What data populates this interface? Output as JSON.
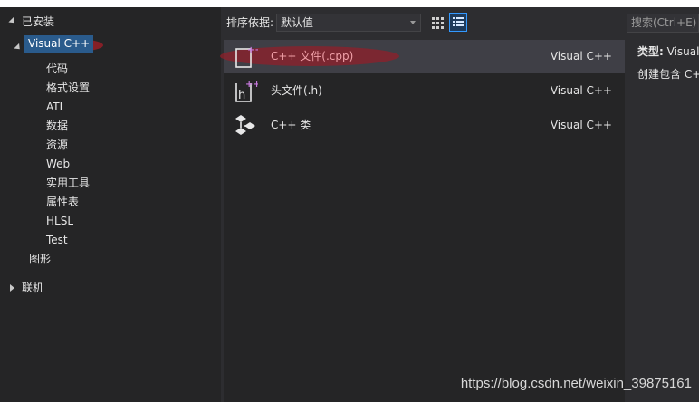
{
  "tree": {
    "installed_label": "已安装",
    "selected": "Visual C++",
    "children": [
      "代码",
      "格式设置",
      "ATL",
      "数据",
      "资源",
      "Web",
      "实用工具",
      "属性表",
      "HLSL",
      "Test"
    ],
    "graphics_label": "图形",
    "online_label": "联机"
  },
  "toolbar": {
    "sort_label": "排序依据:",
    "sort_value": "默认值"
  },
  "templates": [
    {
      "name": "C++ 文件(.cpp)",
      "lang": "Visual C++",
      "icon": "cpp-file-icon"
    },
    {
      "name": "头文件(.h)",
      "lang": "Visual C++",
      "icon": "header-file-icon"
    },
    {
      "name": "C++ 类",
      "lang": "Visual C++",
      "icon": "class-icon"
    }
  ],
  "search": {
    "placeholder": "搜索(Ctrl+E)"
  },
  "details": {
    "type_label": "类型:",
    "type_value": "Visual",
    "description": "创建包含 C+"
  },
  "watermark": "https://blog.csdn.net/weixin_39875161",
  "colors": {
    "accent": "#3399ff",
    "annotation": "#b02a35",
    "selection": "#2a5b8c"
  }
}
